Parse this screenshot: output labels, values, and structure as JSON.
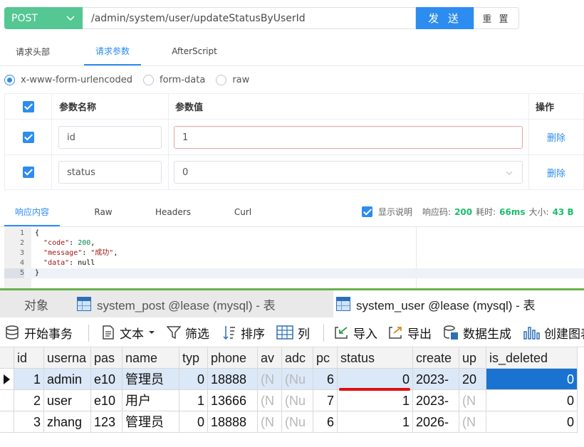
{
  "request": {
    "method": "POST",
    "url": "/admin/system/user/updateStatusByUserId",
    "send_label": "发 送",
    "reset_label": "重 置"
  },
  "request_tabs": [
    "请求头部",
    "请求参数",
    "AfterScript"
  ],
  "active_request_tab": "请求参数",
  "body_types": [
    "x-www-form-urlencoded",
    "form-data",
    "raw"
  ],
  "selected_body_type": "x-www-form-urlencoded",
  "params_table": {
    "headers": {
      "name": "参数名称",
      "value": "参数值",
      "op": "操作"
    },
    "rows": [
      {
        "name": "id",
        "value": "1",
        "action": "删除"
      },
      {
        "name": "status",
        "value": "0",
        "action": "删除"
      }
    ]
  },
  "response_tabs": [
    "响应内容",
    "Raw",
    "Headers",
    "Curl"
  ],
  "active_response_tab": "响应内容",
  "response_meta": {
    "show_desc_label": "显示说明",
    "code_label": "响应码:",
    "code_value": "200",
    "time_label": "耗时:",
    "time_value": "66ms",
    "size_label": "大小:",
    "size_value": "43 B"
  },
  "response_body": {
    "line_numbers": [
      "1",
      "2",
      "3",
      "4",
      "5"
    ],
    "lines": [
      "{",
      "  \"code\": 200,",
      "  \"message\": \"成功\",",
      "  \"data\": null",
      "}"
    ]
  },
  "navicat": {
    "tabs": [
      "对象",
      "system_post @lease (mysql) - 表",
      "system_user @lease (mysql) - 表"
    ],
    "active_tab": "system_user @lease (mysql) - 表",
    "toolbar": [
      "开始事务",
      "文本",
      "筛选",
      "排序",
      "列",
      "导入",
      "导出",
      "数据生成",
      "创建图表"
    ],
    "columns": [
      "id",
      "userna",
      "pas",
      "name",
      "typ",
      "phone",
      "av",
      "adc",
      "pc",
      "status",
      "create",
      "up",
      "is_deleted"
    ],
    "rows": [
      [
        "1",
        "admin",
        "e10",
        "管理员",
        "0",
        "18888",
        "(N",
        "(Nu",
        "6",
        "0",
        "2023-",
        "20",
        "0"
      ],
      [
        "2",
        "user",
        "e10",
        "用户",
        "1",
        "13666",
        "(N",
        "(Nu",
        "7",
        "1",
        "2023-",
        "(N",
        "0"
      ],
      [
        "3",
        "zhang",
        "123",
        "管理员",
        "0",
        "18888",
        "(N",
        "(Nu",
        "6",
        "1",
        "2026-",
        "(N",
        "0"
      ]
    ]
  }
}
